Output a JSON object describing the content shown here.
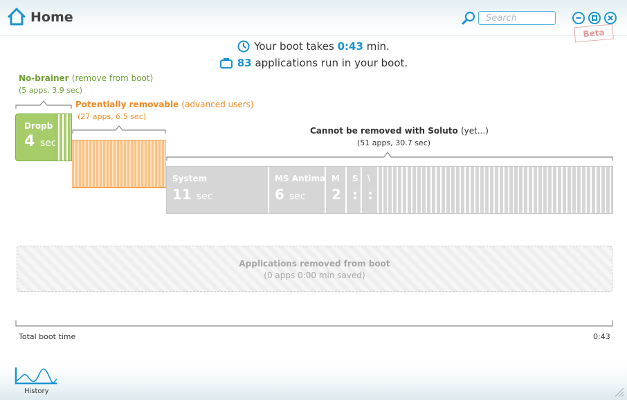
{
  "window": {
    "title": "Home",
    "search_placeholder": "Search",
    "beta_label": "Beta"
  },
  "summary": {
    "boot_prefix": "Your boot takes",
    "boot_time": "0:43",
    "boot_suffix": "min.",
    "app_count": "83",
    "apps_suffix": "applications run in your boot."
  },
  "groups": {
    "no_brainer": {
      "title": "No-brainer",
      "subtitle": "(remove from boot)",
      "stats": "(5 apps, 3.9 sec)",
      "color": "#6e9f36",
      "top_app": {
        "name": "Dropb",
        "time": "4",
        "unit": "sec"
      }
    },
    "potentially_removable": {
      "title": "Potentially removable",
      "subtitle": "(advanced users)",
      "stats": "(27 apps, 6.5 sec)",
      "color": "#f08a24"
    },
    "cannot_remove": {
      "title": "Cannot be removed with Soluto",
      "subtitle": "(yet...)",
      "stats": "(51 apps, 30.7 sec)",
      "color": "#333333",
      "apps": [
        {
          "name": "System",
          "time": "11",
          "unit": "sec"
        },
        {
          "name": "MS Antima",
          "time": "6",
          "unit": "sec"
        },
        {
          "name": "M",
          "time": "2",
          "unit": ""
        },
        {
          "name": "S",
          "time": ":",
          "unit": ""
        },
        {
          "name": "\\",
          "time": ":",
          "unit": ""
        }
      ]
    }
  },
  "removed": {
    "title": "Applications removed from boot",
    "subtitle": "(0 apps 0:00 min saved)"
  },
  "timeline": {
    "start_label": "Total boot time",
    "end_label": "0:43"
  },
  "footer": {
    "history_label": "History"
  },
  "colors": {
    "accent": "#1a93d0",
    "green": "#9ac75a",
    "orange": "#fbc286",
    "gray": "#d6d6d6"
  }
}
